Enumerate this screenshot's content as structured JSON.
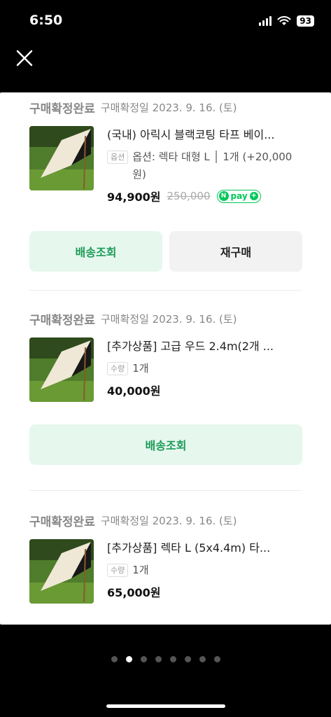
{
  "status_bar": {
    "time": "6:50",
    "battery": "93"
  },
  "orders": [
    {
      "status": "구매확정완료",
      "date": "구매확정일 2023. 9. 16. (토)",
      "product_name": "(국내) 아릭시 블랙코팅 타프 베이...",
      "option_badge": "옵션",
      "option_text": "옵션: 렉타 대형 L │ 1개 (+20,000원)",
      "price": "94,900원",
      "original_price": "250,000",
      "npay_label": "pay",
      "buttons": [
        "배송조회",
        "재구매"
      ]
    },
    {
      "status": "구매확정완료",
      "date": "구매확정일 2023. 9. 16. (토)",
      "product_name": "[추가상품] 고급 우드 2.4m(2개 ...",
      "option_badge": "수량",
      "option_text": "1개",
      "price": "40,000원",
      "buttons": [
        "배송조회"
      ]
    },
    {
      "status": "구매확정완료",
      "date": "구매확정일 2023. 9. 16. (토)",
      "product_name": "[추가상품] 렉타 L (5x4.4m) 타...",
      "option_badge": "수량",
      "option_text": "1개",
      "price": "65,000원"
    }
  ],
  "pagination": {
    "total": 8,
    "active_index": 1
  },
  "colors": {
    "accent_green": "#03c75a",
    "button_green_bg": "#e6f7ee",
    "button_green_text": "#1a9b57"
  }
}
